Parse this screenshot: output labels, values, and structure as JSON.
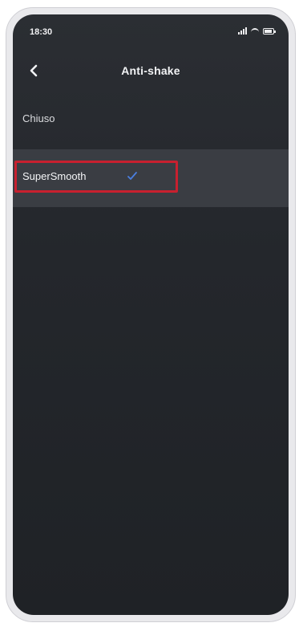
{
  "status_bar": {
    "time": "18:30"
  },
  "header": {
    "title": "Anti-shake",
    "back_icon": "chevron-left-icon"
  },
  "options": [
    {
      "label": "Chiuso",
      "selected": false
    },
    {
      "label": "SuperSmooth",
      "selected": true,
      "indicator_icon": "checkmark-icon"
    }
  ],
  "colors": {
    "background": "#24272c",
    "selected_row": "#3a3d43",
    "checkmark": "#4a7fe0",
    "annotation_highlight": "#c8202f"
  }
}
